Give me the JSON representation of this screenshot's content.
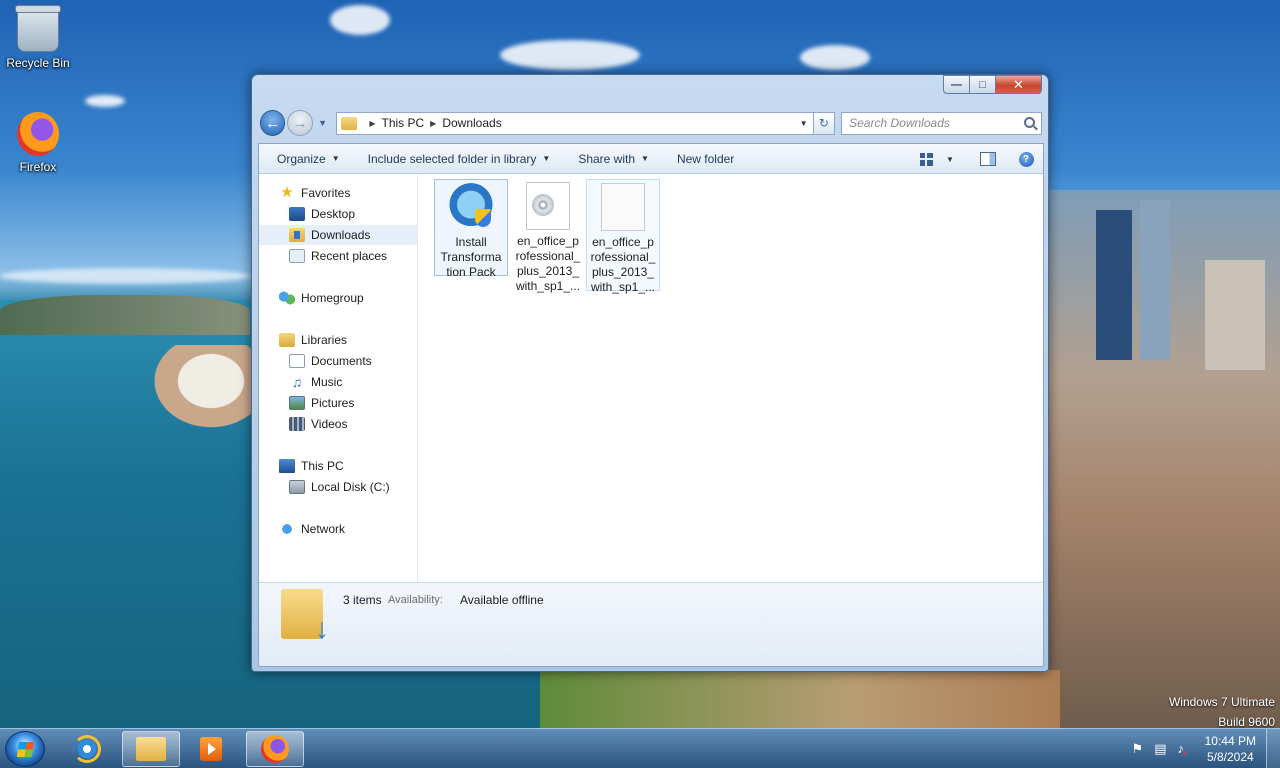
{
  "desktop": {
    "icons": [
      {
        "label": "Recycle Bin"
      },
      {
        "label": "Firefox"
      }
    ],
    "watermark": [
      "Windows 7 Ultimate",
      "Build 9600"
    ]
  },
  "window": {
    "breadcrumb": [
      "This PC",
      "Downloads"
    ],
    "search_placeholder": "Search Downloads",
    "toolbar": {
      "organize": "Organize",
      "include": "Include selected folder in library",
      "share": "Share with",
      "new_folder": "New folder"
    },
    "nav": {
      "favorites": "Favorites",
      "desktop": "Desktop",
      "downloads": "Downloads",
      "recent": "Recent places",
      "homegroup": "Homegroup",
      "libraries": "Libraries",
      "documents": "Documents",
      "music": "Music",
      "pictures": "Pictures",
      "videos": "Videos",
      "this_pc": "This PC",
      "local_disk": "Local Disk (C:)",
      "network": "Network"
    },
    "files": [
      {
        "name": "Install Transforma tion Pack",
        "icon": "installer-icon"
      },
      {
        "name": "en_office_p rofessional_ plus_2013_ with_sp1_...",
        "icon": "disc-image-icon"
      },
      {
        "name": "en_office_p rofessional_ plus_2013_ with_sp1_...",
        "icon": "blank-file-icon"
      }
    ],
    "status": {
      "count": "3 items",
      "availability_label": "Availability:",
      "availability_value": "Available offline"
    }
  },
  "taskbar": {
    "clock_time": "10:44 PM",
    "clock_date": "5/8/2024",
    "pinned": [
      "internet-explorer-icon",
      "windows-explorer-icon",
      "media-player-icon",
      "firefox-icon"
    ]
  }
}
